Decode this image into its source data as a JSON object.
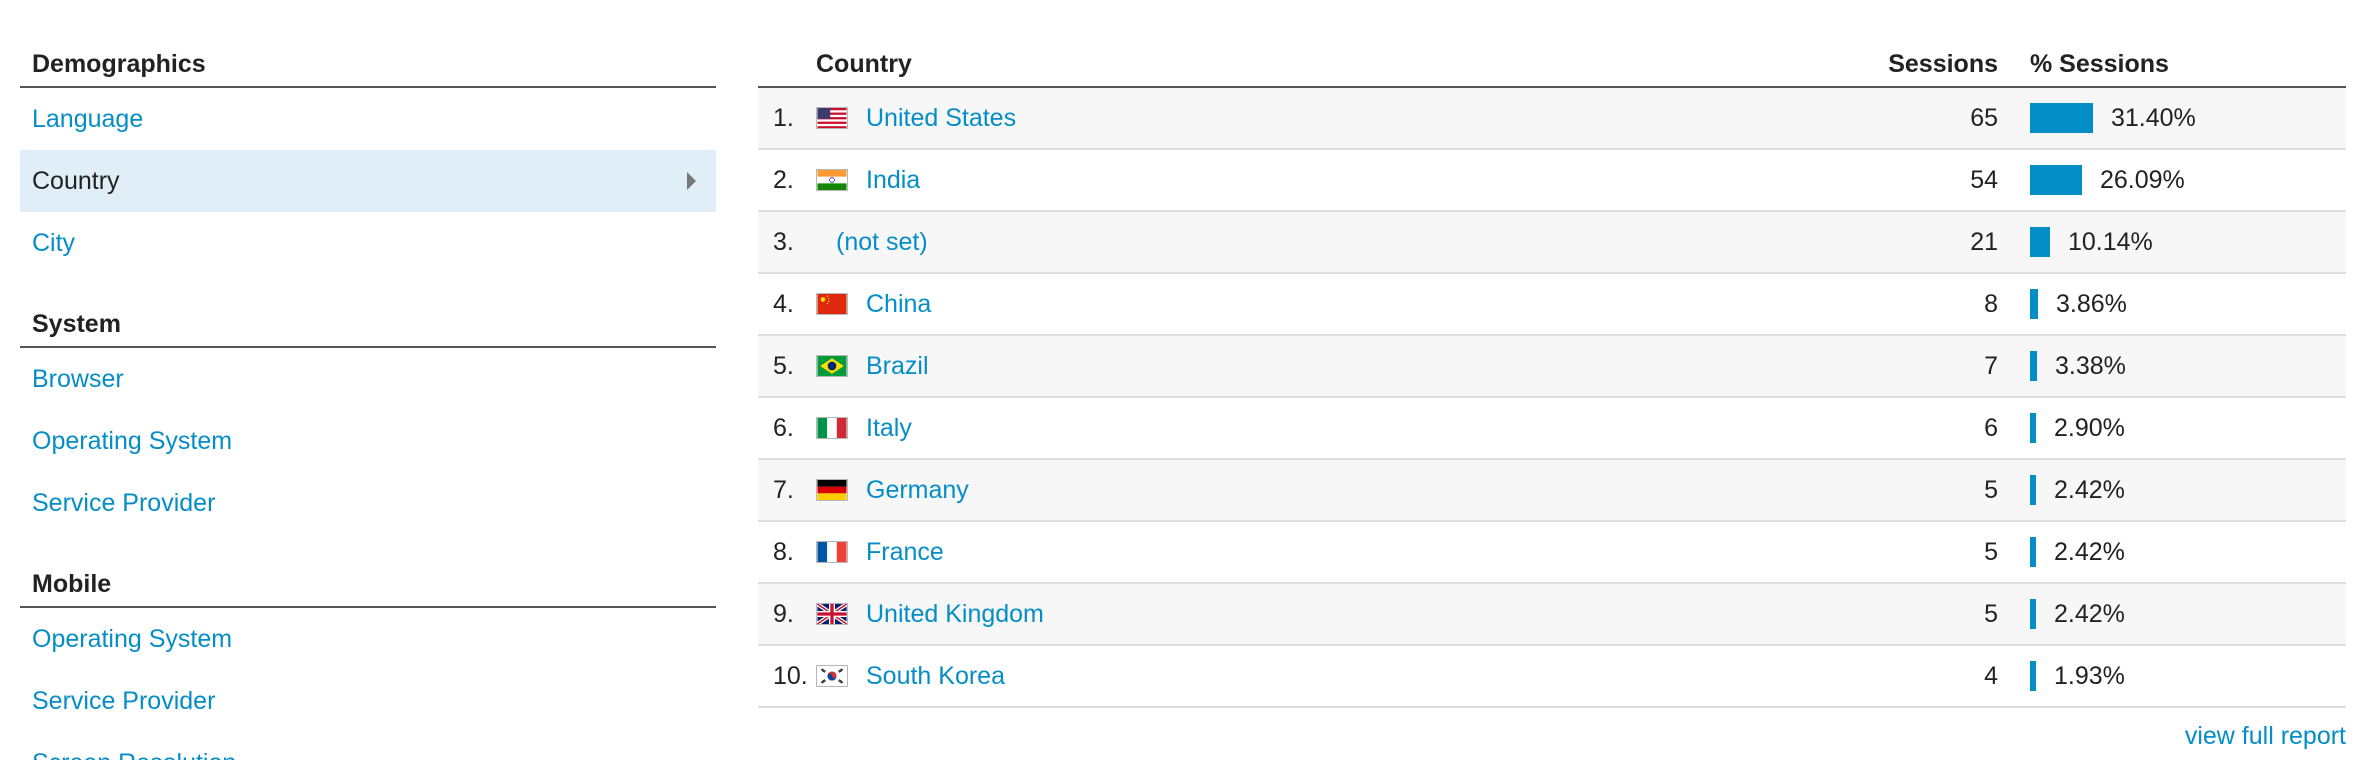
{
  "nav": {
    "sections": [
      {
        "title": "Demographics",
        "items": [
          {
            "label": "Language"
          },
          {
            "label": "Country",
            "selected": true
          },
          {
            "label": "City"
          }
        ]
      },
      {
        "title": "System",
        "items": [
          {
            "label": "Browser"
          },
          {
            "label": "Operating System"
          },
          {
            "label": "Service Provider"
          }
        ]
      },
      {
        "title": "Mobile",
        "items": [
          {
            "label": "Operating System"
          },
          {
            "label": "Service Provider"
          },
          {
            "label": "Screen Resolution"
          }
        ]
      }
    ]
  },
  "report": {
    "columns": {
      "country": "Country",
      "sessions": "Sessions",
      "pct_sessions": "% Sessions"
    },
    "rows": [
      {
        "rank": "1.",
        "country": "United States",
        "flag": "us-flag-icon",
        "sessions": "65",
        "pct": "31.40%",
        "share": 31.4
      },
      {
        "rank": "2.",
        "country": "India",
        "flag": "india-flag-icon",
        "sessions": "54",
        "pct": "26.09%",
        "share": 26.09
      },
      {
        "rank": "3.",
        "country": "(not set)",
        "flag": "",
        "sessions": "21",
        "pct": "10.14%",
        "share": 10.14
      },
      {
        "rank": "4.",
        "country": "China",
        "flag": "china-flag-icon",
        "sessions": "8",
        "pct": "3.86%",
        "share": 3.86
      },
      {
        "rank": "5.",
        "country": "Brazil",
        "flag": "brazil-flag-icon",
        "sessions": "7",
        "pct": "3.38%",
        "share": 3.38
      },
      {
        "rank": "6.",
        "country": "Italy",
        "flag": "italy-flag-icon",
        "sessions": "6",
        "pct": "2.90%",
        "share": 2.9
      },
      {
        "rank": "7.",
        "country": "Germany",
        "flag": "germany-flag-icon",
        "sessions": "5",
        "pct": "2.42%",
        "share": 2.42
      },
      {
        "rank": "8.",
        "country": "France",
        "flag": "france-flag-icon",
        "sessions": "5",
        "pct": "2.42%",
        "share": 2.42
      },
      {
        "rank": "9.",
        "country": "United Kingdom",
        "flag": "uk-flag-icon",
        "sessions": "5",
        "pct": "2.42%",
        "share": 2.42
      },
      {
        "rank": "10.",
        "country": "South Korea",
        "flag": "south-korea-flag-icon",
        "sessions": "4",
        "pct": "1.93%",
        "share": 1.93
      }
    ],
    "view_full_report": "view full report"
  },
  "colors": {
    "link": "#058dc7",
    "bar": "#058dc7",
    "selected_bg": "#e0eff7"
  }
}
